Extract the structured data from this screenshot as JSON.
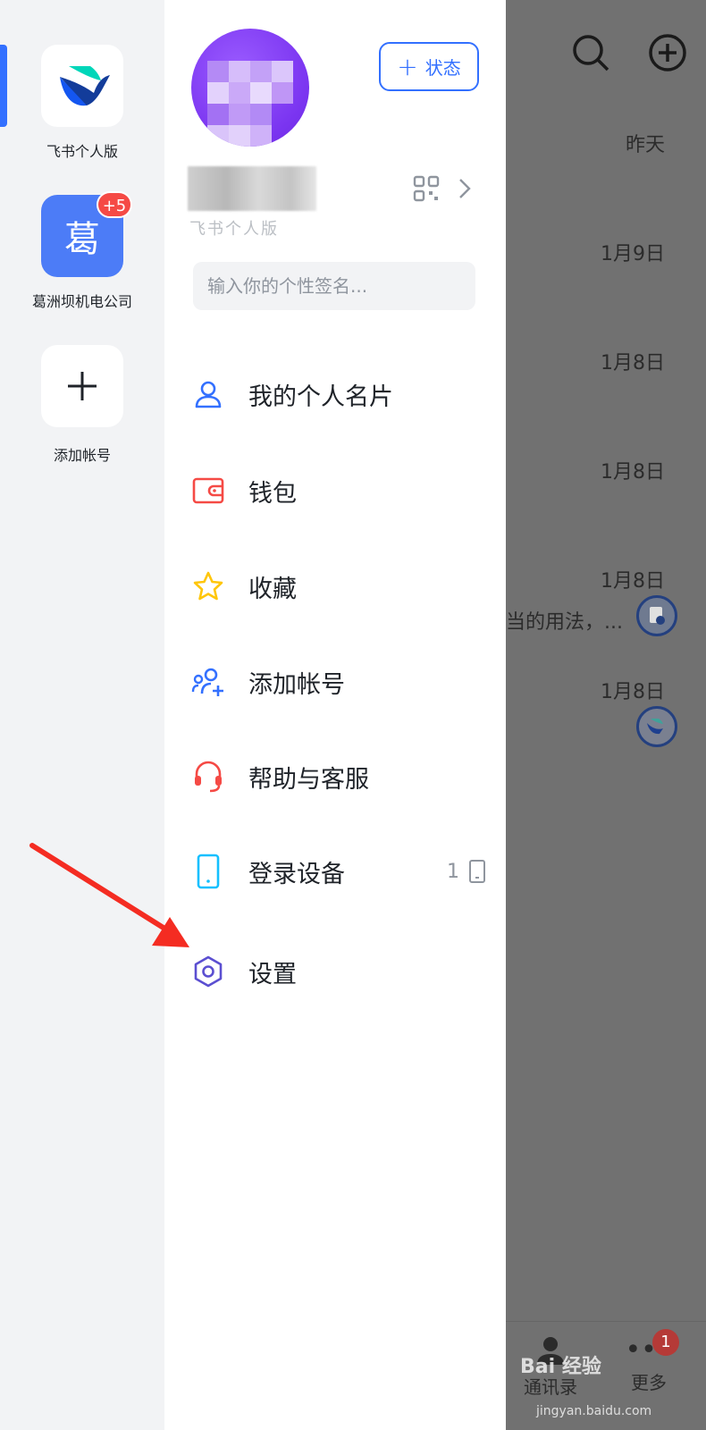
{
  "accounts": [
    {
      "name": "飞书个人版",
      "icon": "feishu-logo-icon"
    },
    {
      "name": "葛洲坝机电公司",
      "avatar_text": "葛",
      "badge": "+5"
    },
    {
      "name": "添加帐号",
      "icon": "plus-icon"
    }
  ],
  "profile": {
    "status_button": "状态",
    "subtitle": "飞书个人版",
    "signature_placeholder": "输入你的个性签名..."
  },
  "menu": [
    {
      "label": "我的个人名片",
      "icon": "person-icon",
      "color": "#3370ff"
    },
    {
      "label": "钱包",
      "icon": "wallet-icon",
      "color": "#f54a45"
    },
    {
      "label": "收藏",
      "icon": "star-icon",
      "color": "#ffc60a"
    },
    {
      "label": "添加帐号",
      "icon": "add-user-icon",
      "color": "#3370ff"
    },
    {
      "label": "帮助与客服",
      "icon": "headset-icon",
      "color": "#f54a45"
    },
    {
      "label": "登录设备",
      "icon": "phone-icon",
      "color": "#14c0ff",
      "extra": "1"
    },
    {
      "label": "设置",
      "icon": "gear-icon",
      "color": "#5b4fd1"
    }
  ],
  "chatlist": {
    "dates": [
      "昨天",
      "1月9日",
      "1月8日",
      "1月8日",
      "1月8日",
      "1月8日"
    ],
    "snippet": "当的用法，...",
    "tabs": [
      "通讯录",
      "更多"
    ],
    "more_badge": "1",
    "watermark": "Bai 经验",
    "watermark_sub": "jingyan.baidu.com"
  },
  "colors": {
    "accent": "#3370ff",
    "badge": "#f54a45",
    "overlay": "#717171"
  }
}
